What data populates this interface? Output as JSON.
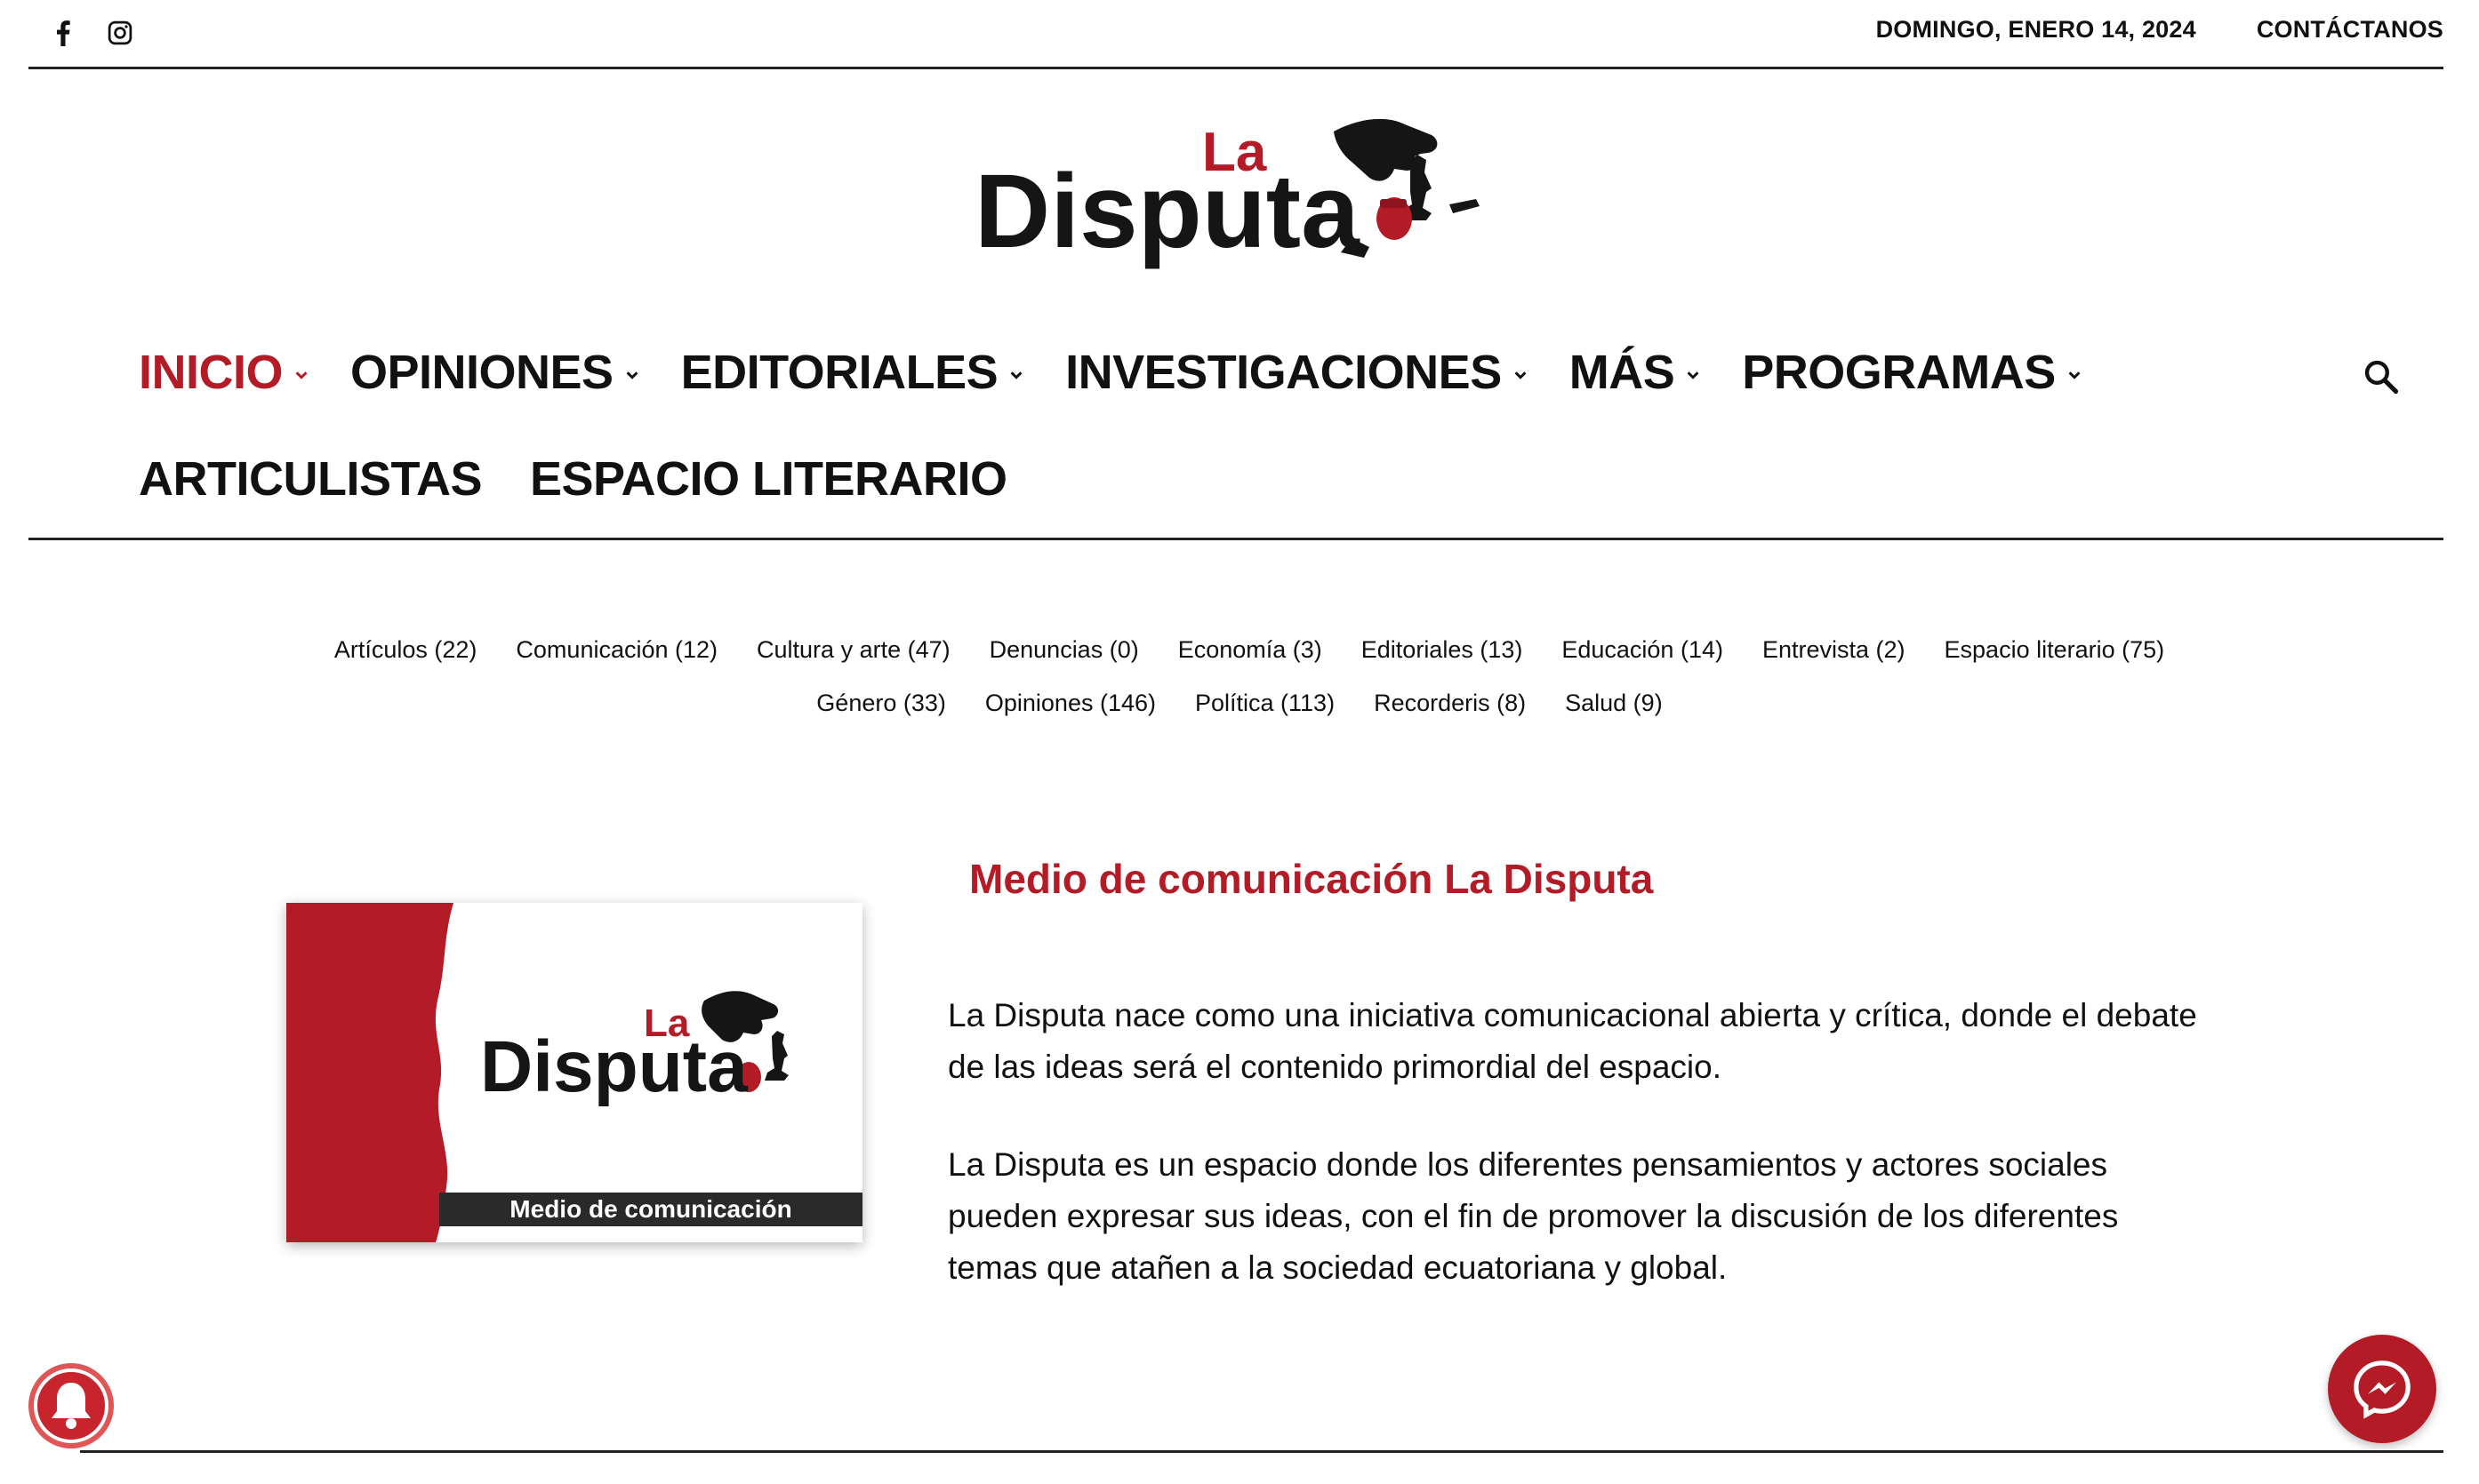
{
  "topbar": {
    "date": "DOMINGO, ENERO 14, 2024",
    "contact_label": "CONTÁCTANOS",
    "social": [
      "facebook-icon",
      "instagram-icon"
    ]
  },
  "logo": {
    "small": "La",
    "main": "Disputa"
  },
  "nav": {
    "items": [
      {
        "label": "INICIO",
        "dropdown": true,
        "active": true
      },
      {
        "label": "OPINIONES",
        "dropdown": true
      },
      {
        "label": "EDITORIALES",
        "dropdown": true
      },
      {
        "label": "INVESTIGACIONES",
        "dropdown": true
      },
      {
        "label": "MÁS",
        "dropdown": true
      },
      {
        "label": "PROGRAMAS",
        "dropdown": true
      },
      {
        "label": "ARTICULISTAS",
        "dropdown": false
      },
      {
        "label": "ESPACIO LITERARIO",
        "dropdown": false
      }
    ],
    "search_icon": "search-icon"
  },
  "categories": [
    "Artículos (22)",
    "Comunicación (12)",
    "Cultura y arte (47)",
    "Denuncias (0)",
    "Economía (3)",
    "Editoriales (13)",
    "Educación (14)",
    "Entrevista (2)",
    "Espacio literario (75)",
    "Género (33)",
    "Opiniones (146)",
    "Política (113)",
    "Recorderis (8)",
    "Salud (9)"
  ],
  "about": {
    "title": "Medio de comunicación La Disputa",
    "p1": "La Disputa nace como una iniciativa comunicacional abierta y crítica, donde el debate de las ideas será el contenido primordial del espacio.",
    "p2": "La Disputa es un espacio donde los diferentes pensamientos y actores sociales pueden expresar sus ideas, con el fin de promover la discusión de los diferentes temas que atañen a la sociedad ecuatoriana y global.",
    "image_caption": "Medio de comunicación"
  },
  "colors": {
    "brand": "#b31b27",
    "text": "#111111"
  }
}
